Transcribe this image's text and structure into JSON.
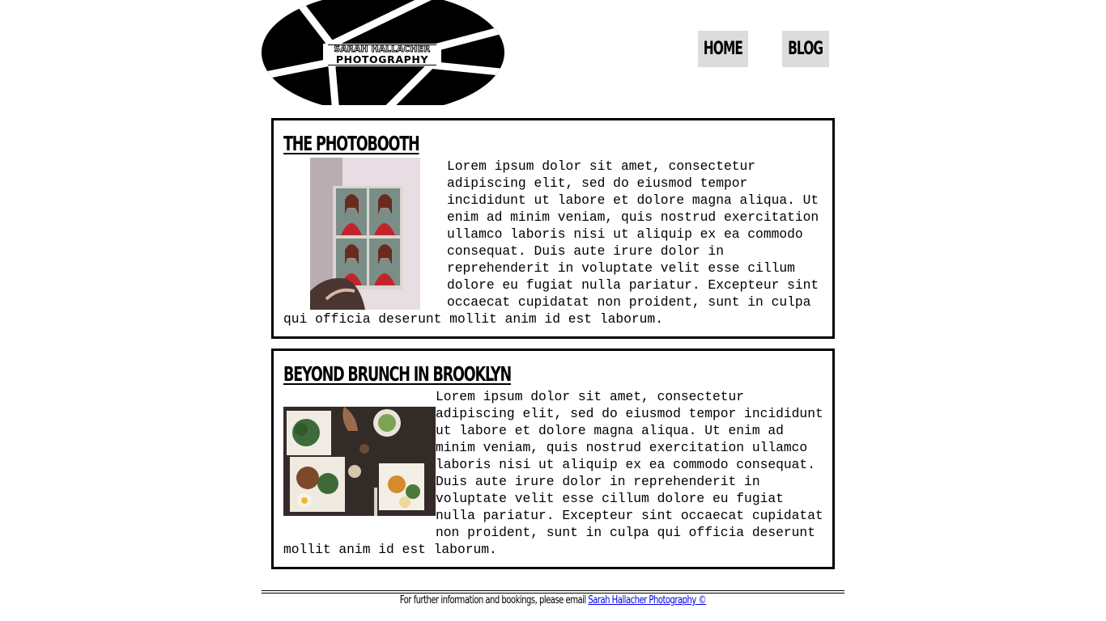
{
  "brand": {
    "logo_line1": "SARAH HALLACHER",
    "logo_line2": "PHOTOGRAPHY"
  },
  "nav": {
    "home_label": "HOME",
    "blog_label": "BLOG"
  },
  "posts": [
    {
      "title": "THE PHOTOBOOTH",
      "body": "Lorem ipsum dolor sit amet, consectetur adipiscing elit, sed do eiusmod tempor incididunt ut labore et dolore magna aliqua. Ut enim ad minim veniam, quis nostrud exercitation ullamco laboris nisi ut aliquip ex ea commodo consequat. Duis aute irure dolor in reprehenderit in voluptate velit esse cillum dolore eu fugiat nulla pariatur. Excepteur sint occaecat cupidatat non proident, sunt in culpa qui officia deserunt mollit anim id est laborum."
    },
    {
      "title": "BEYOND BRUNCH IN BROOKLYN",
      "body": "Lorem ipsum dolor sit amet, consectetur adipiscing elit, sed do eiusmod tempor incididunt ut labore et dolore magna aliqua. Ut enim ad minim veniam, quis nostrud exercitation ullamco laboris nisi ut aliquip ex ea commodo consequat. Duis aute irure dolor in reprehenderit in voluptate velit esse cillum dolore eu fugiat nulla pariatur. Excepteur sint occaecat cupidatat non proident, sunt in culpa qui officia deserunt mollit anim id est laborum."
    }
  ],
  "footer": {
    "text": "For further information and bookings, please email ",
    "link_label": "Sarah Hallacher Photography ©"
  },
  "colors": {
    "nav_bg": "#dcdcdc",
    "link": "#0000ee",
    "border": "#000000"
  }
}
